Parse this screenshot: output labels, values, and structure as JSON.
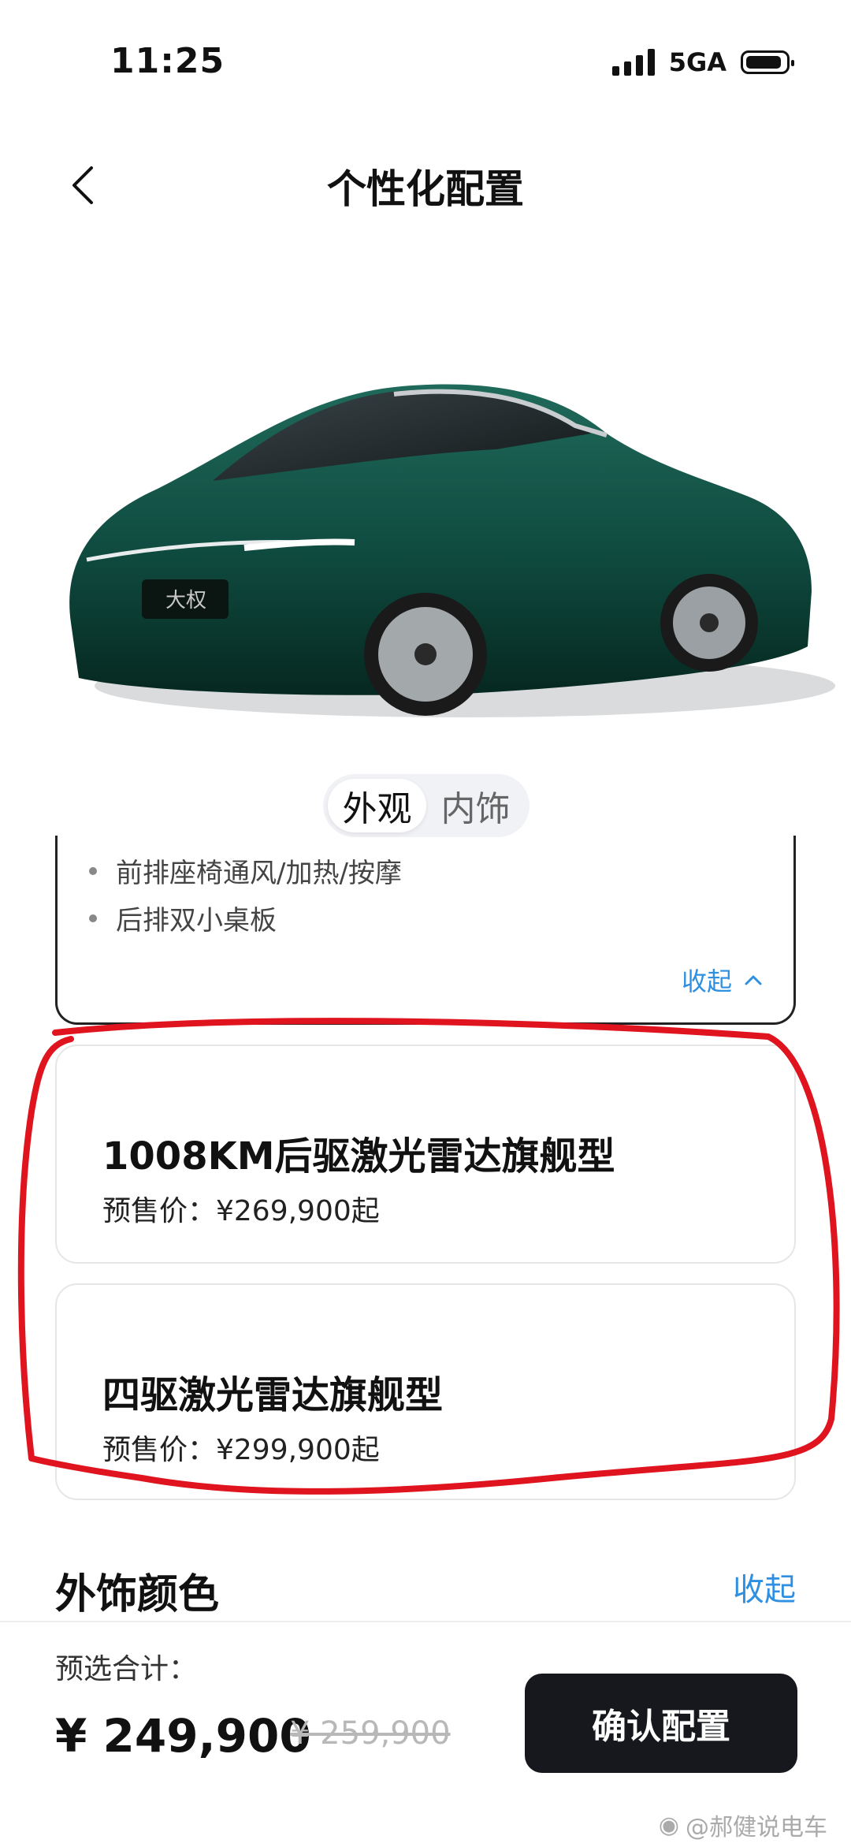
{
  "status_bar": {
    "time": "11:25",
    "network": "5GA"
  },
  "header": {
    "title": "个性化配置"
  },
  "view_toggle": {
    "tabs": [
      "外观",
      "内饰"
    ],
    "selected": "外观"
  },
  "features": {
    "items": [
      "前排座椅通风/加热/按摩",
      "后排双小桌板"
    ],
    "collapse_label": "收起"
  },
  "trims": [
    {
      "name": "1008KM后驱激光雷达旗舰型",
      "price": "预售价：¥269,900起"
    },
    {
      "name": "四驱激光雷达旗舰型",
      "price": "预售价：¥299,900起"
    }
  ],
  "exterior_color": {
    "title": "外饰颜色",
    "collapse_label": "收起"
  },
  "bottom_bar": {
    "total_label": "预选合计：",
    "price_now": "¥ 249,900",
    "price_old": "¥ 259,900",
    "confirm_label": "确认配置"
  },
  "watermark": "@郝健说电车",
  "colors": {
    "accent_blue": "#2f8fe0",
    "dark_button": "#16181d",
    "car_green": "#0f4a3f",
    "annotation_red": "#e0141e"
  }
}
